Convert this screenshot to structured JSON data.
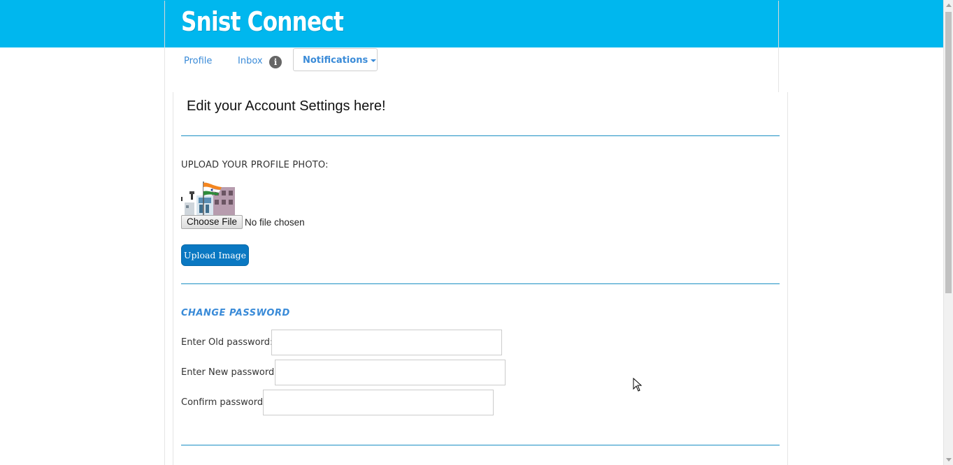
{
  "brand": {
    "title": "Snist Connect"
  },
  "nav": {
    "profile": "Profile",
    "inbox": "Inbox",
    "inbox_badge": "i",
    "notifications": "Notifications"
  },
  "page": {
    "title": "Edit your Account Settings here!"
  },
  "upload": {
    "label": "UPLOAD YOUR PROFILE PHOTO:",
    "choose_button": "Choose File",
    "file_status": "No file chosen",
    "upload_button": "Upload Image"
  },
  "password": {
    "section_title": "CHANGE PASSWORD",
    "old_label": "Enter Old password:",
    "new_label": "Enter New password:",
    "confirm_label": "Confirm password:",
    "old_value": "",
    "new_value": "",
    "confirm_value": ""
  },
  "colors": {
    "header": "#00b7ee",
    "link": "#3a8bd8",
    "primary_button": "#0a78c2",
    "divider": "#1b8fc4"
  }
}
